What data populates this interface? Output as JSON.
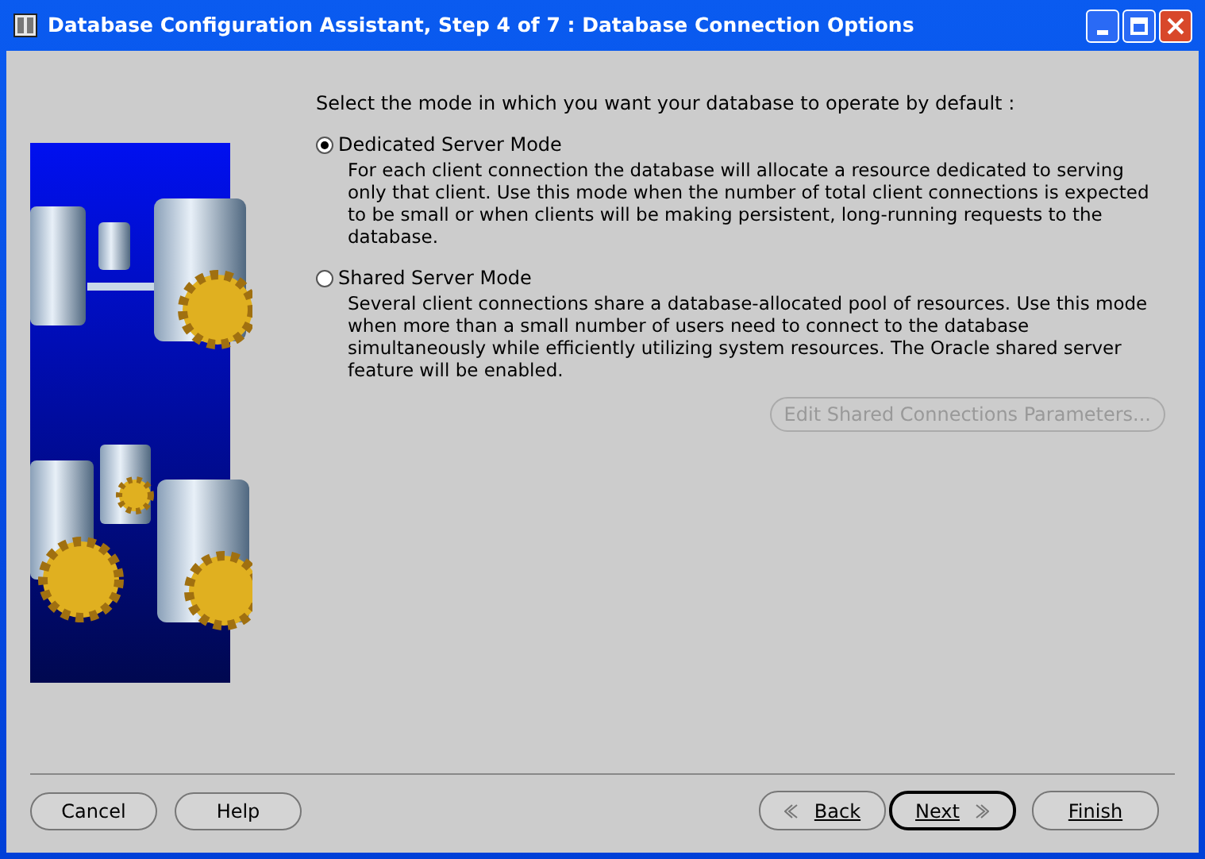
{
  "window": {
    "title": "Database Configuration Assistant, Step 4 of 7 : Database Connection Options"
  },
  "prompt": "Select the mode in which you want your database to operate by default :",
  "modes": [
    {
      "label": "Dedicated Server Mode",
      "selected": true,
      "description": "For each client connection the database will allocate a resource dedicated to serving only that client.  Use this mode when the number of total client connections is expected to be small or when clients will be making persistent, long-running requests to the database."
    },
    {
      "label": "Shared Server Mode",
      "selected": false,
      "description": "Several client connections share a database-allocated pool of resources.  Use this mode when more than a small number of users need to connect to the database simultaneously while efficiently utilizing system resources.  The Oracle shared server feature will be enabled."
    }
  ],
  "edit_button": {
    "label": "Edit Shared Connections Parameters...",
    "disabled": true
  },
  "left_buttons": [
    "Cancel",
    "Help"
  ],
  "nav_buttons": [
    {
      "kind": "back",
      "label": "Back",
      "default": false
    },
    {
      "kind": "next",
      "label": "Next",
      "default": true
    },
    {
      "kind": "finish",
      "label": "Finish",
      "default": false
    }
  ]
}
